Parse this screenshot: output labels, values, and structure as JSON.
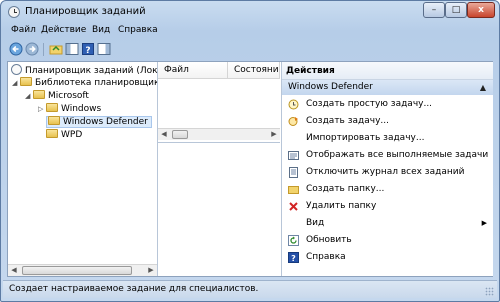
{
  "window": {
    "title": "Планировщик заданий"
  },
  "window_buttons": {
    "minimize": "–",
    "maximize": "□",
    "close": "x"
  },
  "menu": [
    "Файл",
    "Действие",
    "Вид",
    "Справка"
  ],
  "toolbar": {
    "icons": [
      "back-icon",
      "forward-icon",
      "up-folder-icon",
      "show-hide-tree-icon",
      "help-icon",
      "show-hide-action-pane-icon"
    ]
  },
  "tree": {
    "root": "Планировщик заданий (Локальн",
    "library": "Библиотека планировщика з",
    "microsoft": "Microsoft",
    "windows": "Windows",
    "defender": "Windows Defender",
    "wpd": "WPD"
  },
  "tasklist": {
    "columns": [
      "Файл",
      "Состояни"
    ]
  },
  "actions": {
    "header": "Действия",
    "selected": "Windows Defender",
    "items": [
      {
        "label": "Создать простую задачу...",
        "icon": "create-basic-task-icon"
      },
      {
        "label": "Создать задачу...",
        "icon": "create-task-icon"
      },
      {
        "label": "Импортировать задачу...",
        "icon": ""
      },
      {
        "label": "Отображать все выполняемые задачи",
        "icon": "running-tasks-icon"
      },
      {
        "label": "Отключить журнал всех заданий",
        "icon": "history-icon"
      },
      {
        "label": "Создать папку...",
        "icon": "new-folder-icon"
      },
      {
        "label": "Удалить папку",
        "icon": "delete-icon"
      },
      {
        "label": "Вид",
        "icon": "",
        "submenu": "▶"
      },
      {
        "label": "Обновить",
        "icon": "refresh-icon"
      },
      {
        "label": "Справка",
        "icon": "help-icon"
      }
    ]
  },
  "status": {
    "text": "Создает настраиваемое задание для специалистов."
  },
  "colors": {
    "accent": "#c3d6ee",
    "delete": "#d22424",
    "help": "#2450a8"
  }
}
